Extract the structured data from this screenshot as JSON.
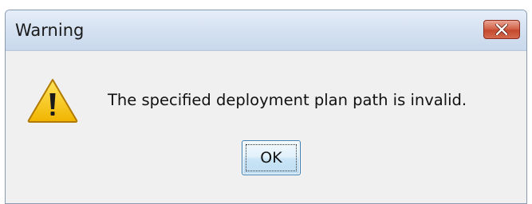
{
  "window": {
    "title": "Warning",
    "close_icon": "close-icon"
  },
  "dialog": {
    "icon": "warning-icon",
    "message": "The specified deployment plan path is invalid.",
    "ok_label": "OK"
  },
  "colors": {
    "titlebar": "#d3e0f0",
    "close_button": "#c34a2f",
    "content_bg": "#f0f0f0",
    "ok_border": "#3c7fb1",
    "warning_fill": "#f5c400"
  }
}
